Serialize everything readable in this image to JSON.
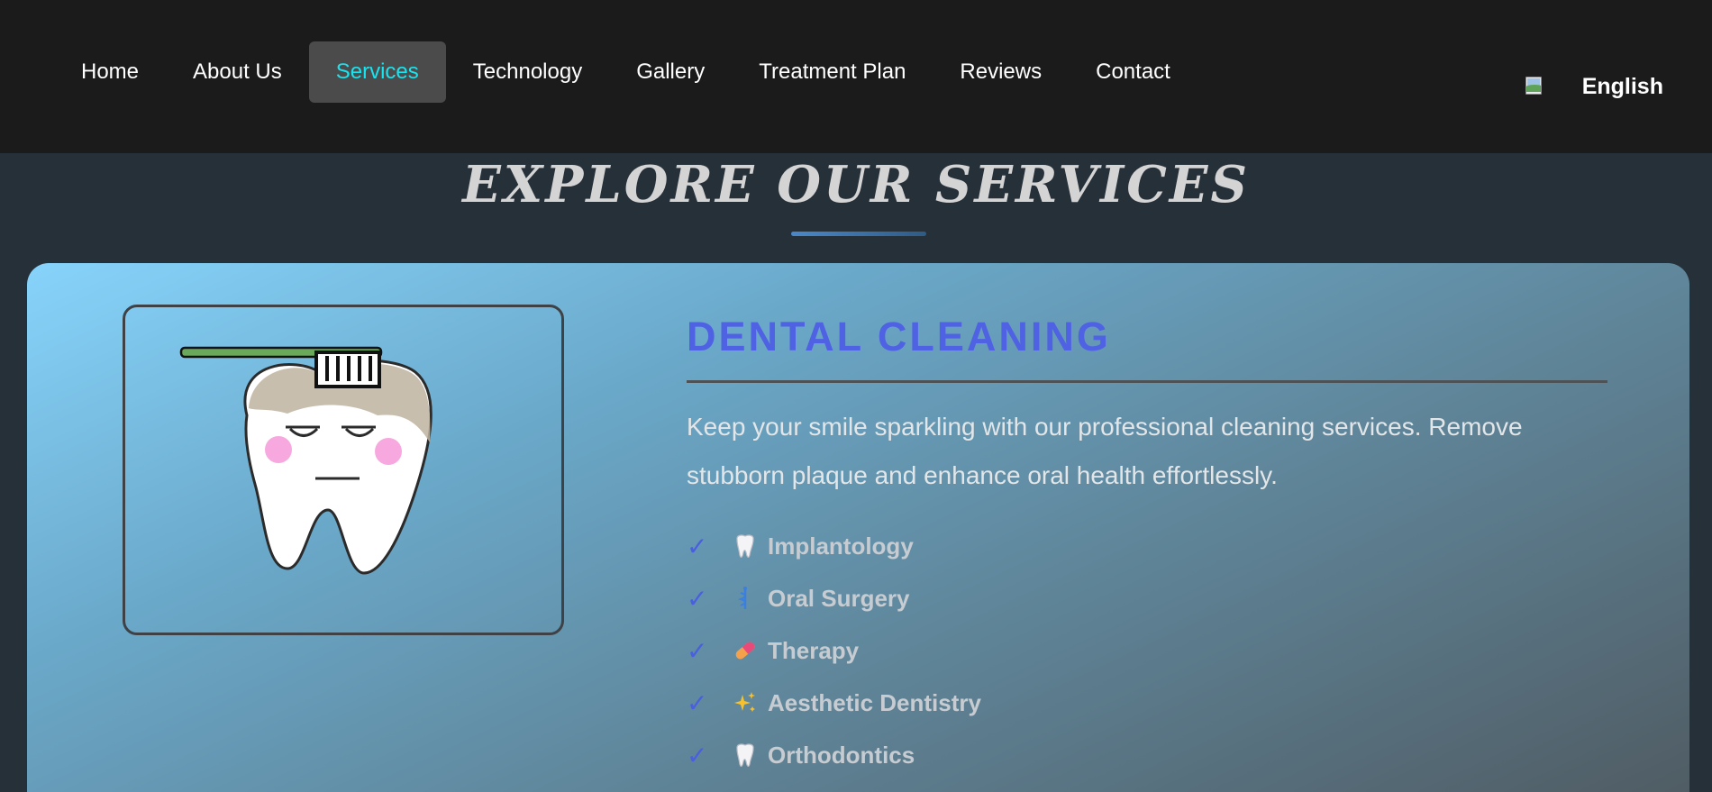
{
  "nav": {
    "items": [
      {
        "label": "Home"
      },
      {
        "label": "About Us"
      },
      {
        "label": "Services"
      },
      {
        "label": "Technology"
      },
      {
        "label": "Gallery"
      },
      {
        "label": "Treatment Plan"
      },
      {
        "label": "Reviews"
      },
      {
        "label": "Contact"
      }
    ],
    "active_label": "Services",
    "language": "English",
    "language_icon": "broken-image-icon"
  },
  "section": {
    "title": "EXPLORE OUR SERVICES"
  },
  "service": {
    "title": "DENTAL CLEANING",
    "description": "Keep your smile sparkling with our professional cleaning services. Remove stubborn plaque and enhance oral health effortlessly.",
    "image_icon": "tooth-with-toothbrush-illustration",
    "features": [
      {
        "label": "Implantology",
        "icon": "tooth-icon"
      },
      {
        "label": "Oral Surgery",
        "icon": "medical-staff-icon"
      },
      {
        "label": "Therapy",
        "icon": "pill-icon"
      },
      {
        "label": "Aesthetic Dentistry",
        "icon": "sparkles-icon"
      },
      {
        "label": "Orthodontics",
        "icon": "tooth-icon"
      }
    ]
  },
  "colors": {
    "nav_bg": "#1b1b1b",
    "nav_active_text": "#17e4ef",
    "title_blue": "#4f62e3",
    "check_blue": "#4a5fe0"
  }
}
